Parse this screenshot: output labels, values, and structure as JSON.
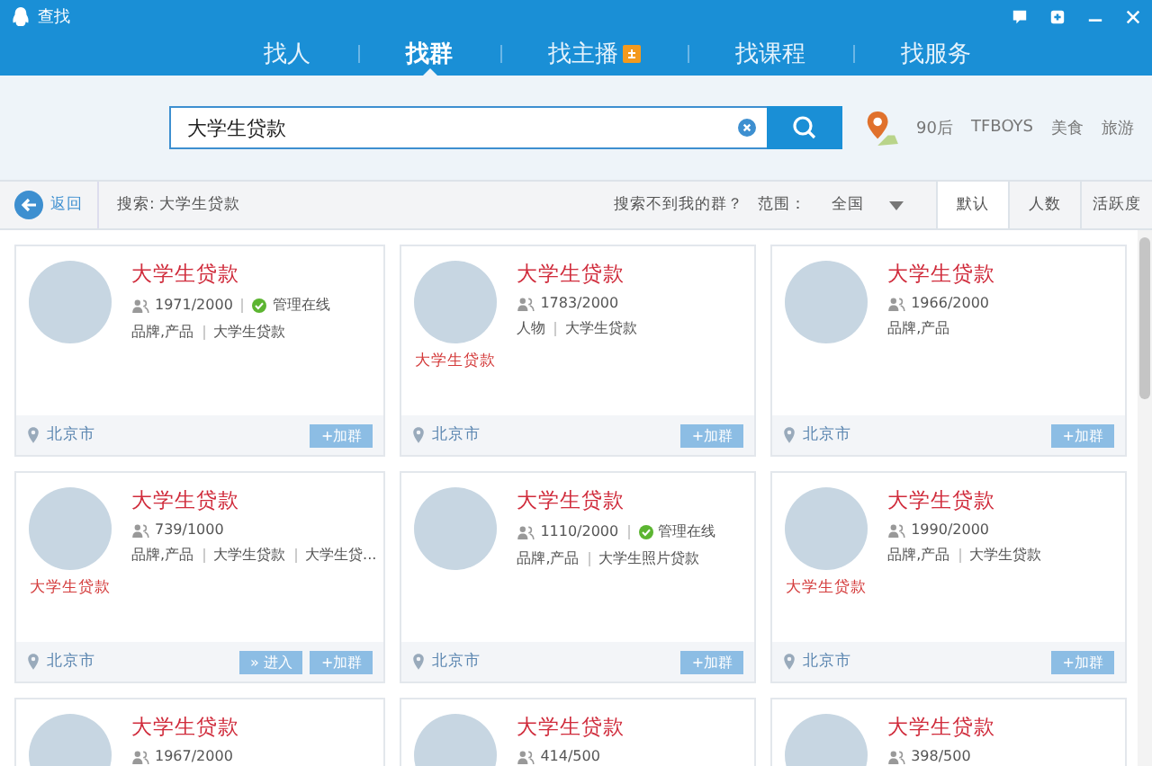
{
  "window": {
    "title": "查找"
  },
  "nav_tabs": [
    {
      "label": "找人",
      "selected": false,
      "hot": false
    },
    {
      "label": "找群",
      "selected": true,
      "hot": false
    },
    {
      "label": "找主播",
      "selected": false,
      "hot": true
    },
    {
      "label": "找课程",
      "selected": false,
      "hot": false
    },
    {
      "label": "找服务",
      "selected": false,
      "hot": false
    }
  ],
  "search": {
    "value": "大学生贷款"
  },
  "quick_tags": [
    "90后",
    "TFBOYS",
    "美食",
    "旅游"
  ],
  "filter_bar": {
    "back": "返回",
    "query": "搜索: 大学生贷款",
    "help_link": "搜索不到我的群？",
    "range_label": "范围：",
    "range_value": "全国"
  },
  "sort_tabs": [
    {
      "label": "默认",
      "selected": true
    },
    {
      "label": "人数",
      "selected": false
    },
    {
      "label": "活跃度",
      "selected": false
    }
  ],
  "cards": [
    {
      "title": "大学生贷款",
      "members": "1971/2000",
      "admin_online": true,
      "admin_text": "管理在线",
      "tags": [
        "品牌,产品",
        "大学生贷款"
      ],
      "location": "北京市",
      "buttons": [
        "+加群"
      ]
    },
    {
      "title": "大学生贷款",
      "members": "1783/2000",
      "admin_online": false,
      "tags": [
        "人物",
        "大学生贷款"
      ],
      "avatar_label": "大学生贷款",
      "location": "北京市",
      "buttons": [
        "+加群"
      ]
    },
    {
      "title": "大学生贷款",
      "members": "1966/2000",
      "admin_online": false,
      "tags": [
        "品牌,产品"
      ],
      "location": "北京市",
      "buttons": [
        "+加群"
      ]
    },
    {
      "title": "大学生贷款",
      "members": "739/1000",
      "admin_online": false,
      "tags": [
        "品牌,产品",
        "大学生贷款",
        "大学生贷..."
      ],
      "avatar_label": "大学生贷款",
      "location": "北京市",
      "buttons": [
        "» 进入",
        "+加群"
      ]
    },
    {
      "title": "大学生贷款",
      "members": "1110/2000",
      "admin_online": true,
      "admin_text": "管理在线",
      "tags": [
        "品牌,产品",
        "大学生照片贷款"
      ],
      "location": "北京市",
      "buttons": [
        "+加群"
      ]
    },
    {
      "title": "大学生贷款",
      "members": "1990/2000",
      "admin_online": false,
      "tags": [
        "品牌,产品",
        "大学生贷款"
      ],
      "avatar_label": "大学生贷款",
      "location": "北京市",
      "buttons": [
        "+加群"
      ]
    },
    {
      "title": "大学生贷款",
      "members": "1967/2000",
      "admin_online": false
    },
    {
      "title": "大学生贷款",
      "members": "414/500",
      "admin_online": false
    },
    {
      "title": "大学生贷款",
      "members": "398/500",
      "admin_online": false
    }
  ]
}
